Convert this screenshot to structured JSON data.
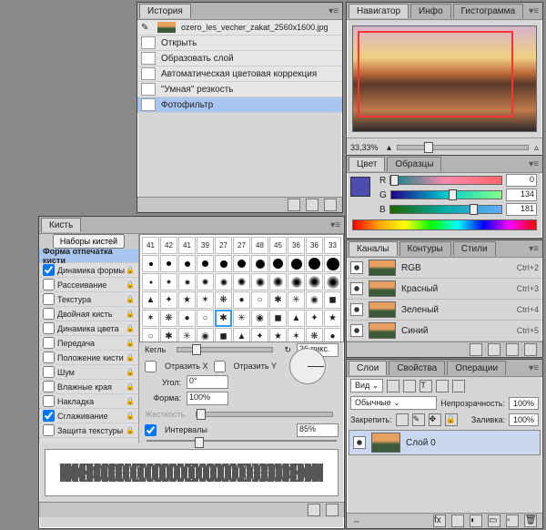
{
  "history": {
    "tab": "История",
    "file": "ozero_les_vecher_zakat_2560x1600.jpg",
    "items": [
      "Открыть",
      "Образовать слой",
      "Автоматическая цветовая коррекция",
      "\"Умная\" резкость",
      "Фотофильтр"
    ],
    "selected_index": 4
  },
  "navigator": {
    "tabs": [
      "Навигатор",
      "Инфо",
      "Гистограмма"
    ],
    "zoom": "33,33%"
  },
  "color": {
    "tabs": [
      "Цвет",
      "Образцы"
    ],
    "r_label": "R",
    "g_label": "G",
    "b_label": "B",
    "r": "0",
    "g": "134",
    "b": "181"
  },
  "channels": {
    "tabs": [
      "Каналы",
      "Контуры",
      "Стили"
    ],
    "items": [
      {
        "name": "RGB",
        "sc": "Ctrl+2"
      },
      {
        "name": "Красный",
        "sc": "Ctrl+3"
      },
      {
        "name": "Зеленый",
        "sc": "Ctrl+4"
      },
      {
        "name": "Синий",
        "sc": "Ctrl+5"
      }
    ]
  },
  "layers": {
    "tabs": [
      "Слои",
      "Свойства",
      "Операции"
    ],
    "kind_label": "Вид",
    "mode": "Обычные",
    "opacity_label": "Непрозрачность:",
    "opacity": "100%",
    "lock_label": "Закрепить:",
    "fill_label": "Заливка:",
    "fill": "100%",
    "layer_name": "Слой 0"
  },
  "brush": {
    "tab": "Кисть",
    "presets_btn": "Наборы кистей",
    "header": "Форма отпечатка кисти",
    "options": [
      {
        "label": "Динамика формы",
        "checked": true,
        "lock": true
      },
      {
        "label": "Рассеивание",
        "checked": false,
        "lock": true
      },
      {
        "label": "Текстура",
        "checked": false,
        "lock": true
      },
      {
        "label": "Двойная кисть",
        "checked": false,
        "lock": true
      },
      {
        "label": "Динамика цвета",
        "checked": false,
        "lock": true
      },
      {
        "label": "Передача",
        "checked": false,
        "lock": true
      },
      {
        "label": "Положение кисти",
        "checked": false,
        "lock": true
      },
      {
        "label": "Шум",
        "checked": false,
        "lock": true
      },
      {
        "label": "Влажные края",
        "checked": false,
        "lock": true
      },
      {
        "label": "Накладка",
        "checked": false,
        "lock": true
      },
      {
        "label": "Сглаживание",
        "checked": true,
        "lock": true
      },
      {
        "label": "Защита текстуры",
        "checked": false,
        "lock": true
      }
    ],
    "size_label": "Кегль",
    "size": "26 пикс.",
    "flipx": "Отразить X",
    "flipy": "Отразить Y",
    "angle_label": "Угол:",
    "angle": "0°",
    "round_label": "Форма:",
    "round": "100%",
    "hardness_label": "Жесткость",
    "spacing_label": "Интервалы",
    "spacing": "85%",
    "grid_numbers": [
      "41",
      "42",
      "41",
      "39",
      "27",
      "27",
      "48",
      "45",
      "36",
      "36",
      "33"
    ]
  }
}
